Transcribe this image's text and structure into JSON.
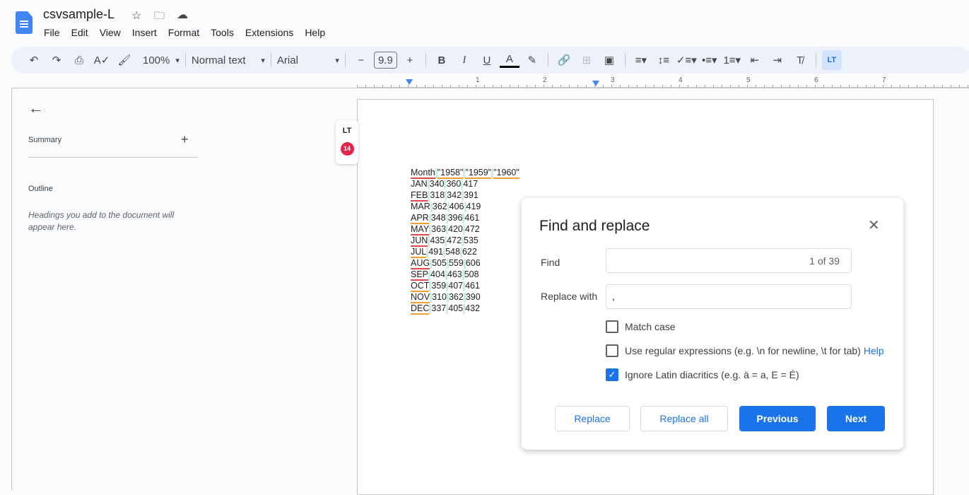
{
  "app": {
    "title": "csvsample-L",
    "menu": [
      "File",
      "Edit",
      "View",
      "Insert",
      "Format",
      "Tools",
      "Extensions",
      "Help"
    ]
  },
  "toolbar": {
    "zoom": "100%",
    "style": "Normal text",
    "font": "Arial",
    "font_size": "9.9"
  },
  "ruler": [
    "1",
    "2",
    "3",
    "4",
    "5",
    "6",
    "7"
  ],
  "sidebar": {
    "summary": "Summary",
    "outline": "Outline",
    "hint": "Headings you add to the document will appear here."
  },
  "addon": {
    "badge": "14",
    "logo": "LT"
  },
  "document": {
    "header": [
      "Month",
      "\"1958\"",
      "\"1959\"",
      "\"1960\""
    ],
    "rows": [
      [
        "JAN",
        "340",
        "360",
        "417"
      ],
      [
        "FEB",
        "318",
        "342",
        "391"
      ],
      [
        "MAR",
        "362",
        "406",
        "419"
      ],
      [
        "APR",
        "348",
        "396",
        "461"
      ],
      [
        "MAY",
        "363",
        "420",
        "472"
      ],
      [
        "JUN",
        "435",
        "472",
        "535"
      ],
      [
        "JUL",
        "491",
        "548",
        "622"
      ],
      [
        "AUG",
        "505",
        "559",
        "606"
      ],
      [
        "SEP",
        "404",
        "463",
        "508"
      ],
      [
        "OCT",
        "359",
        "407",
        "461"
      ],
      [
        "NOV",
        "310",
        "362",
        "390"
      ],
      [
        "DEC",
        "337",
        "405",
        "432"
      ]
    ]
  },
  "dialog": {
    "title": "Find and replace",
    "find_label": "Find",
    "find_value": "",
    "find_count": "1 of 39",
    "replace_label": "Replace with",
    "replace_value": ",",
    "match_case": "Match case",
    "regex": "Use regular expressions (e.g. \\n for newline, \\t for tab)",
    "help": "Help",
    "ignore": "Ignore Latin diacritics (e.g. ä = a, E = É)",
    "match_case_checked": false,
    "regex_checked": false,
    "ignore_checked": true,
    "buttons": {
      "replace": "Replace",
      "replace_all": "Replace all",
      "previous": "Previous",
      "next": "Next"
    }
  },
  "colors": {
    "accent": "#1a73e8",
    "badge": "#e8234a"
  }
}
